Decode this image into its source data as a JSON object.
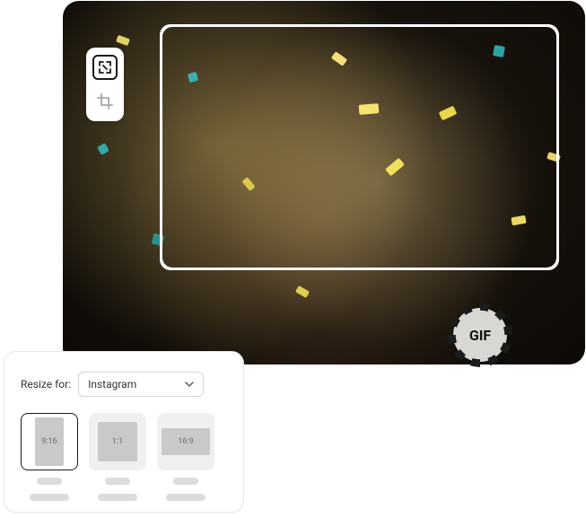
{
  "editor": {
    "tools": {
      "resize_icon": "resize-icon",
      "crop_icon": "crop-icon"
    },
    "gif_badge": "GIF"
  },
  "resize_panel": {
    "label": "Resize for:",
    "dropdown_value": "Instagram",
    "ratios": [
      {
        "label": "9:16",
        "selected": true
      },
      {
        "label": "1:1",
        "selected": false
      },
      {
        "label": "16:9",
        "selected": false
      }
    ]
  }
}
